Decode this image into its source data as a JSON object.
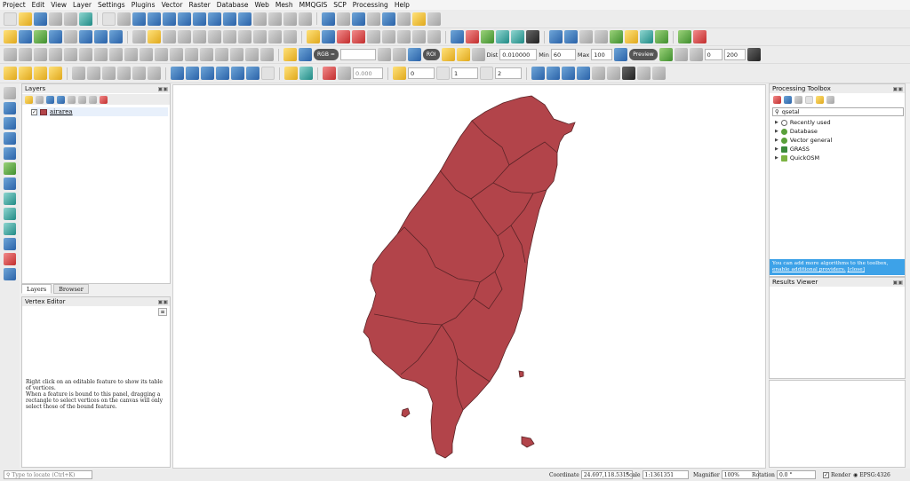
{
  "menu": [
    "Project",
    "Edit",
    "View",
    "Layer",
    "Settings",
    "Plugins",
    "Vector",
    "Raster",
    "Database",
    "Web",
    "Mesh",
    "MMQGIS",
    "SCP",
    "Processing",
    "Help"
  ],
  "toolbar": {
    "rgb_label": "RGB =",
    "roi_label": "ROI",
    "dist_label": "Dist",
    "dist_value": "0.010000",
    "min_label": "Min",
    "min_value": "60",
    "max_label": "Max",
    "max_value": "100",
    "preview_label": "Preview",
    "t_value": "0",
    "t2_value": "200",
    "opacity_value": "0.000",
    "spin1": "0",
    "spin2": "1",
    "spin3": "2"
  },
  "layers_panel": {
    "title": "Layers",
    "layer_name": "airarea",
    "layer_color": "#b2444a"
  },
  "tabs": [
    "Layers",
    "Browser"
  ],
  "vertex_panel": {
    "title": "Vertex Editor",
    "text1": "Right click on an editable feature to show its table of vertices.",
    "text2": "When a feature is bound to this panel, dragging a rectangle to select vertices on the canvas will only select those of the bound feature."
  },
  "processing_panel": {
    "title": "Processing Toolbox",
    "search_value": "qsetal",
    "items": [
      "Recently used",
      "Database",
      "Vector general",
      "GRASS",
      "QuickOSM"
    ],
    "note_text": "You can add more algorithms to the toolbox, ",
    "note_link": "enable additional providers.",
    "note_close": "[close]"
  },
  "results_panel": {
    "title": "Results Viewer"
  },
  "statusbar": {
    "locate_placeholder": "Type to locate (Ctrl+K)",
    "coordinate_label": "Coordinate",
    "coordinate_value": "24.697,118.531°",
    "scale_label": "Scale",
    "scale_value": "1:1361351",
    "magnifier_label": "Magnifier",
    "magnifier_value": "100%",
    "rotation_label": "Rotation",
    "rotation_value": "0.0 °",
    "render_label": "Render",
    "crs_label": "EPSG:4326"
  },
  "map": {
    "fill": "#b2444a",
    "stroke": "#5b2427"
  }
}
